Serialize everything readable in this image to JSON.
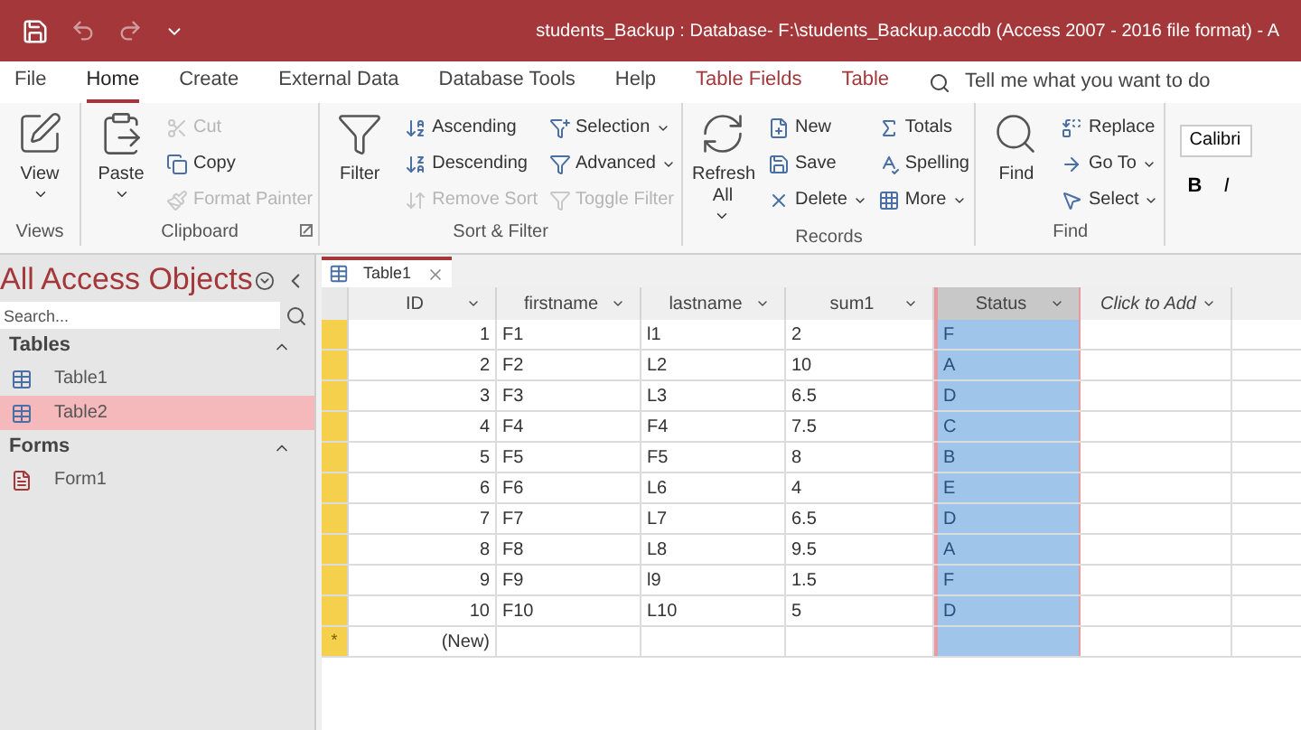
{
  "window": {
    "title": "students_Backup : Database- F:\\students_Backup.accdb (Access 2007 - 2016 file format)  -  A"
  },
  "menu_tabs": [
    {
      "label": "File",
      "kind": "plain",
      "selected": false
    },
    {
      "label": "Home",
      "kind": "plain",
      "selected": true
    },
    {
      "label": "Create",
      "kind": "plain",
      "selected": false
    },
    {
      "label": "External Data",
      "kind": "plain",
      "selected": false
    },
    {
      "label": "Database Tools",
      "kind": "plain",
      "selected": false
    },
    {
      "label": "Help",
      "kind": "plain",
      "selected": false
    },
    {
      "label": "Table Fields",
      "kind": "contextual",
      "selected": false
    },
    {
      "label": "Table",
      "kind": "contextual",
      "selected": false
    }
  ],
  "tell_me": {
    "placeholder": "Tell me what you want to do"
  },
  "ribbon": [
    {
      "label": "Views",
      "launcher": false,
      "items": [
        {
          "kind": "large",
          "label": "View",
          "dropdown": true,
          "disabled": false
        }
      ]
    },
    {
      "label": "Clipboard",
      "launcher": true,
      "items": [
        {
          "kind": "large",
          "label": "Paste",
          "dropdown": true,
          "disabled": false
        },
        {
          "kind": "small",
          "label": "Cut",
          "dropdown": false,
          "disabled": true
        },
        {
          "kind": "small",
          "label": "Copy",
          "dropdown": false,
          "disabled": false
        },
        {
          "kind": "small",
          "label": "Format Painter",
          "dropdown": false,
          "disabled": true
        }
      ]
    },
    {
      "label": "Sort & Filter",
      "launcher": false,
      "items": [
        {
          "kind": "large",
          "label": "Filter",
          "dropdown": false,
          "disabled": false
        },
        {
          "kind": "small",
          "label": "Ascending",
          "dropdown": false,
          "disabled": false
        },
        {
          "kind": "small",
          "label": "Descending",
          "dropdown": false,
          "disabled": false
        },
        {
          "kind": "small",
          "label": "Remove Sort",
          "dropdown": false,
          "disabled": true
        },
        {
          "kind": "small",
          "label": "Selection",
          "dropdown": true,
          "disabled": false
        },
        {
          "kind": "small",
          "label": "Advanced",
          "dropdown": true,
          "disabled": false
        },
        {
          "kind": "small",
          "label": "Toggle Filter",
          "dropdown": false,
          "disabled": true
        }
      ]
    },
    {
      "label": "Records",
      "launcher": false,
      "items": [
        {
          "kind": "large",
          "label": "Refresh All",
          "dropdown": true,
          "disabled": false
        },
        {
          "kind": "small",
          "label": "New",
          "dropdown": false,
          "disabled": false
        },
        {
          "kind": "small",
          "label": "Save",
          "dropdown": false,
          "disabled": false
        },
        {
          "kind": "small",
          "label": "Delete",
          "dropdown": true,
          "disabled": false
        },
        {
          "kind": "small",
          "label": "Totals",
          "dropdown": false,
          "disabled": false
        },
        {
          "kind": "small",
          "label": "Spelling",
          "dropdown": false,
          "disabled": false
        },
        {
          "kind": "small",
          "label": "More",
          "dropdown": true,
          "disabled": false
        }
      ]
    },
    {
      "label": "Find",
      "launcher": false,
      "items": [
        {
          "kind": "large",
          "label": "Find",
          "dropdown": false,
          "disabled": false
        },
        {
          "kind": "small",
          "label": "Replace",
          "dropdown": false,
          "disabled": false
        },
        {
          "kind": "small",
          "label": "Go To",
          "dropdown": true,
          "disabled": false
        },
        {
          "kind": "small",
          "label": "Select",
          "dropdown": true,
          "disabled": false
        }
      ]
    }
  ],
  "font": {
    "name": "Calibri",
    "bold": "B",
    "italic": "I"
  },
  "nav_pane": {
    "title": "All Access Objects",
    "search": {
      "placeholder": "Search..."
    },
    "groups": [
      {
        "label": "Tables",
        "expanded": true,
        "items": [
          {
            "label": "Table1",
            "kind": "table",
            "selected": false
          },
          {
            "label": "Table2",
            "kind": "table",
            "selected": true
          }
        ]
      },
      {
        "label": "Forms",
        "expanded": true,
        "items": [
          {
            "label": "Form1",
            "kind": "form",
            "selected": false
          }
        ]
      }
    ]
  },
  "document_tab": {
    "label": "Table1"
  },
  "table": {
    "columns": [
      {
        "label": "ID",
        "selected": false,
        "italic": false
      },
      {
        "label": "firstname",
        "selected": false,
        "italic": false
      },
      {
        "label": "lastname",
        "selected": false,
        "italic": false
      },
      {
        "label": "sum1",
        "selected": false,
        "italic": false
      },
      {
        "label": "Status",
        "selected": true,
        "italic": false
      },
      {
        "label": "Click to Add",
        "selected": false,
        "italic": true
      }
    ],
    "rows": [
      [
        "1",
        "F1",
        "l1",
        "2",
        "F"
      ],
      [
        "2",
        "F2",
        "L2",
        "10",
        "A"
      ],
      [
        "3",
        "F3",
        "L3",
        "6.5",
        "D"
      ],
      [
        "4",
        "F4",
        "F4",
        "7.5",
        "C"
      ],
      [
        "5",
        "F5",
        "F5",
        "8",
        "B"
      ],
      [
        "6",
        "F6",
        "L6",
        "4",
        "E"
      ],
      [
        "7",
        "F7",
        "L7",
        "6.5",
        "D"
      ],
      [
        "8",
        "F8",
        "L8",
        "9.5",
        "A"
      ],
      [
        "9",
        "F9",
        "l9",
        "1.5",
        "F"
      ],
      [
        "10",
        "F10",
        "L10",
        "5",
        "D"
      ]
    ],
    "new_row": {
      "marker": "*",
      "label": "(New)"
    }
  }
}
